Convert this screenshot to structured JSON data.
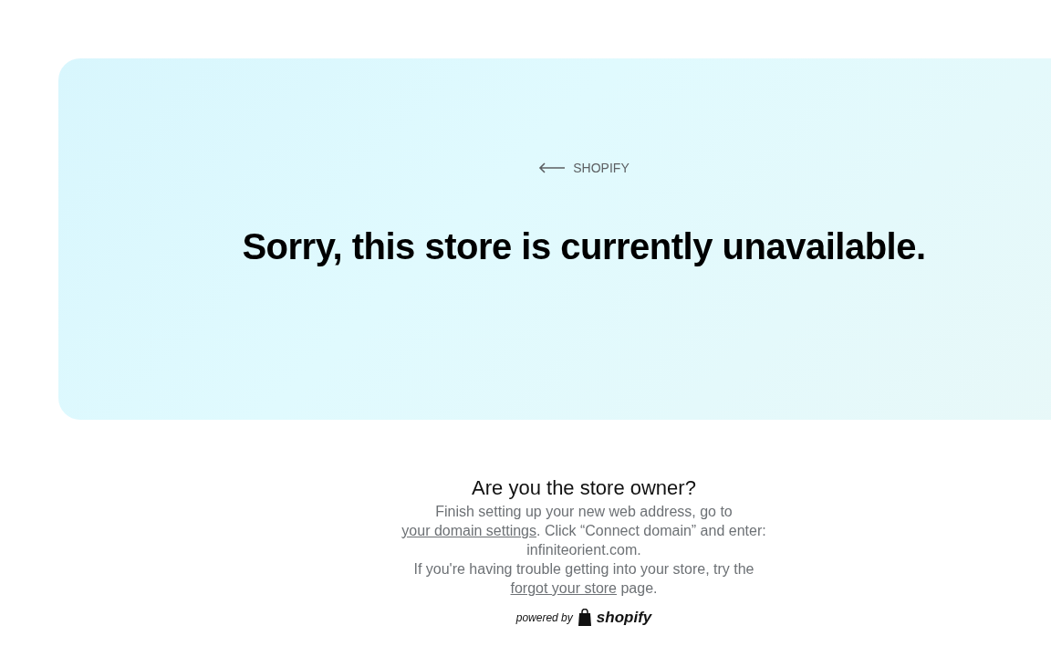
{
  "hero": {
    "back_link": "SHOPIFY",
    "heading": "Sorry, this store is currently unavailable."
  },
  "owner_section": {
    "heading": "Are you the store owner?",
    "paragraphs": [
      {
        "before": "Finish setting up your new web address, go to ",
        "link": "your domain settings",
        "after": ". Click “Connect domain” and enter: infiniteorient.com."
      },
      {
        "before": "If you're having trouble getting into your store, try the ",
        "link": "forgot your store",
        "after": " page."
      }
    ]
  },
  "footer": {
    "powered_by": "powered by",
    "brand": "shopify"
  }
}
